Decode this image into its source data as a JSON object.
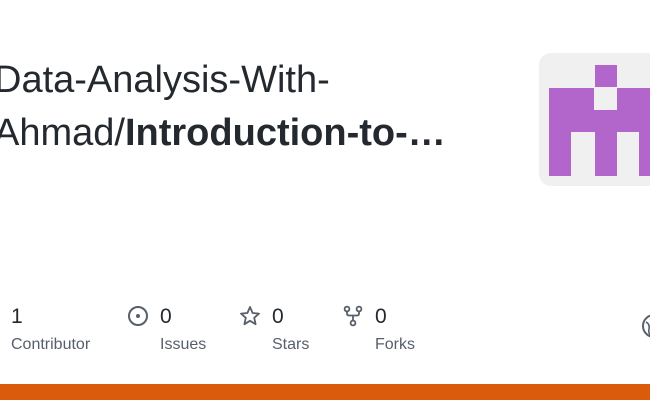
{
  "repo": {
    "owner_line1": "Data-Analysis-With-",
    "owner_line2": "Ahmad/",
    "name": "Introduction-to-…"
  },
  "stats": {
    "contributors": {
      "count": "1",
      "label": "Contributor"
    },
    "issues": {
      "count": "0",
      "label": "Issues",
      "icon": "issue-opened-icon"
    },
    "stars": {
      "count": "0",
      "label": "Stars",
      "icon": "star-icon"
    },
    "forks": {
      "count": "0",
      "label": "Forks",
      "icon": "repo-forked-icon"
    }
  },
  "colors": {
    "avatar_fg": "#b266cc",
    "avatar_bg": "#f0f0f0",
    "language_bar": "#DA5B0B",
    "text_primary": "#24292f",
    "text_secondary": "#57606a"
  },
  "icons": {
    "corner": "globe-icon"
  }
}
